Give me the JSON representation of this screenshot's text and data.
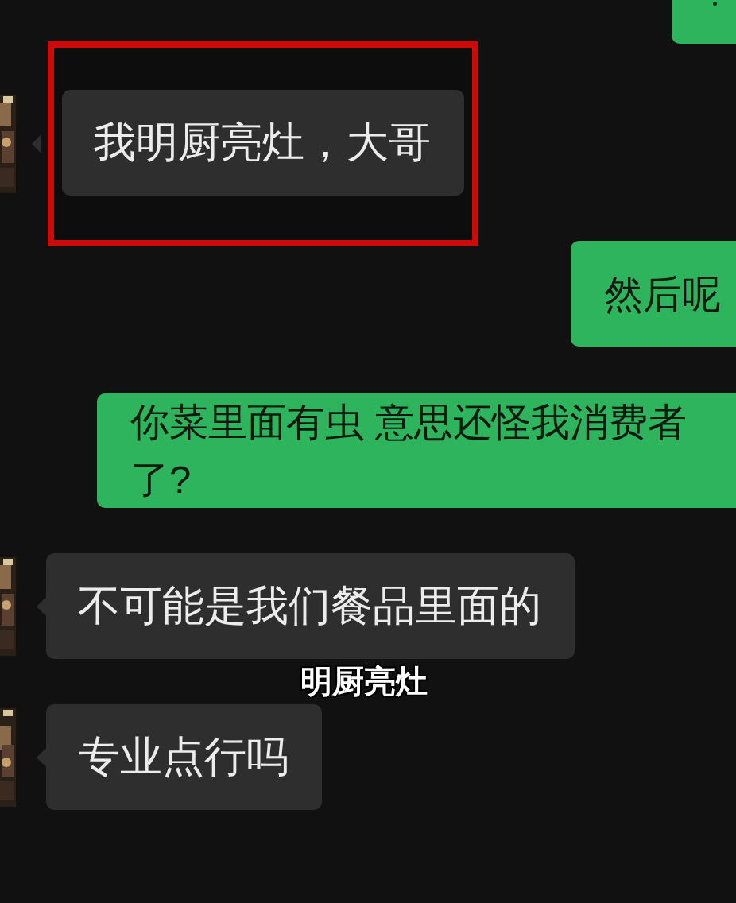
{
  "messages": [
    {
      "kind": "incoming",
      "highlighted": true,
      "lines": [
        "我明厨亮灶，大哥"
      ]
    },
    {
      "kind": "outgoing",
      "lines": [
        "然后呢"
      ]
    },
    {
      "kind": "outgoing",
      "lines": [
        "你菜里面有虫 意思还怪我消费者",
        "了?"
      ]
    },
    {
      "kind": "incoming",
      "highlighted": false,
      "lines": [
        "不可能是我们餐品里面的"
      ]
    },
    {
      "kind": "subtitle",
      "lines": [
        "明厨亮灶"
      ]
    },
    {
      "kind": "incoming",
      "highlighted": false,
      "lines": [
        "专业点行吗"
      ]
    }
  ]
}
